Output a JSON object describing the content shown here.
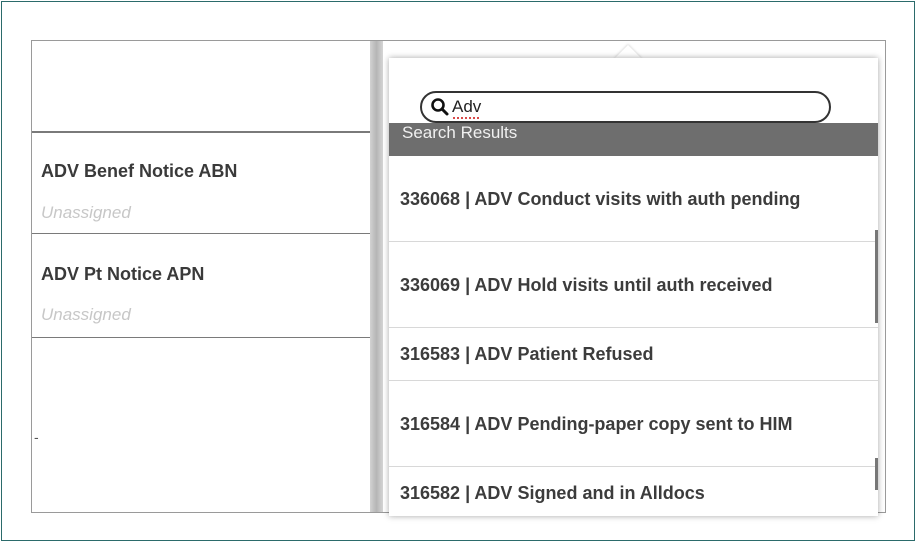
{
  "fields": [
    {
      "title": "ADV Benef Notice ABN",
      "value": "Unassigned"
    },
    {
      "title": "ADV Pt Notice APN",
      "value": "Unassigned"
    }
  ],
  "left_marker": "-",
  "search": {
    "value": "Adv",
    "icon": "search-icon"
  },
  "results_header": "Search Results",
  "results": [
    {
      "label": "336068 | ADV Conduct visits with auth pending"
    },
    {
      "label": "336069 | ADV Hold visits until auth received"
    },
    {
      "label": "316583 | ADV Patient Refused"
    },
    {
      "label": "316584 | ADV Pending-paper copy sent to HIM"
    },
    {
      "label": "316582 | ADV Signed and in Alldocs"
    }
  ],
  "colors": {
    "frame": "#2b6b6b",
    "header_bg": "#6e6e6e"
  }
}
